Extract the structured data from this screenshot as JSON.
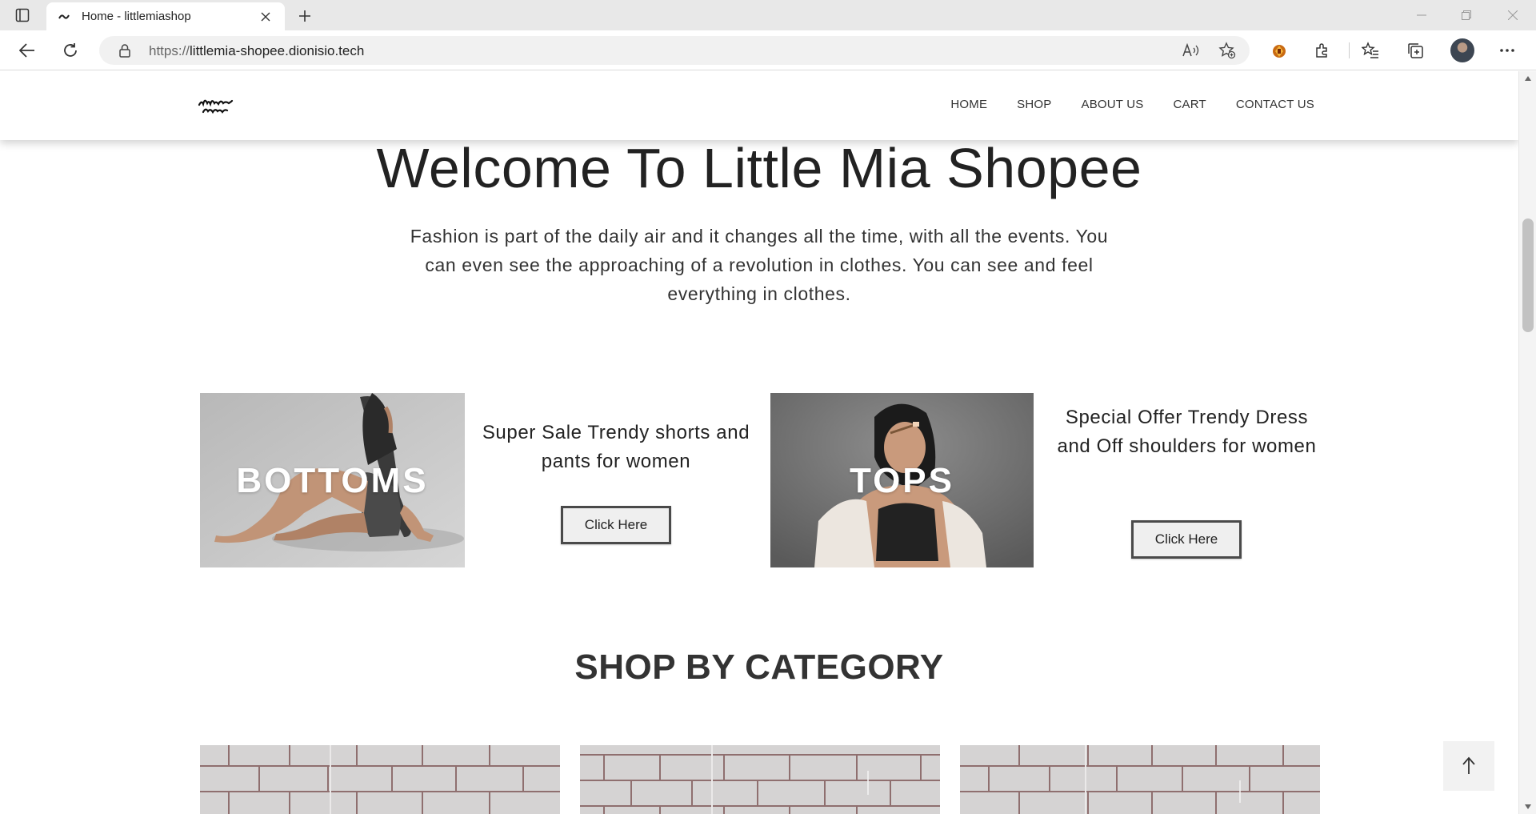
{
  "browser": {
    "tab_title": "Home - littlemiashop",
    "url_proto": "https://",
    "url_host": "littlemia-shopee.dionisio.tech"
  },
  "site": {
    "logo_text": "littlemia Shopee",
    "nav": [
      "HOME",
      "SHOP",
      "ABOUT US",
      "CART",
      "CONTACT US"
    ]
  },
  "hero": {
    "title": "Welcome To Little Mia Shopee",
    "subtitle": "Fashion is part of the daily air and it changes all the time, with all the events. You can even see the approaching of a revolution in clothes. You can see and feel everything in clothes."
  },
  "promos": [
    {
      "image_caption": "BOTTOMS",
      "text": "Super Sale Trendy shorts and pants for women",
      "button": "Click Here"
    },
    {
      "image_caption": "TOPS",
      "text": "Special Offer Trendy Dress and Off shoulders for women",
      "button": "Click Here"
    }
  ],
  "categories": {
    "title": "SHOP BY CATEGORY"
  },
  "colors": {
    "accent": "#4a4a4a",
    "header_bg": "#ffffff",
    "button_bg": "#efefef"
  }
}
